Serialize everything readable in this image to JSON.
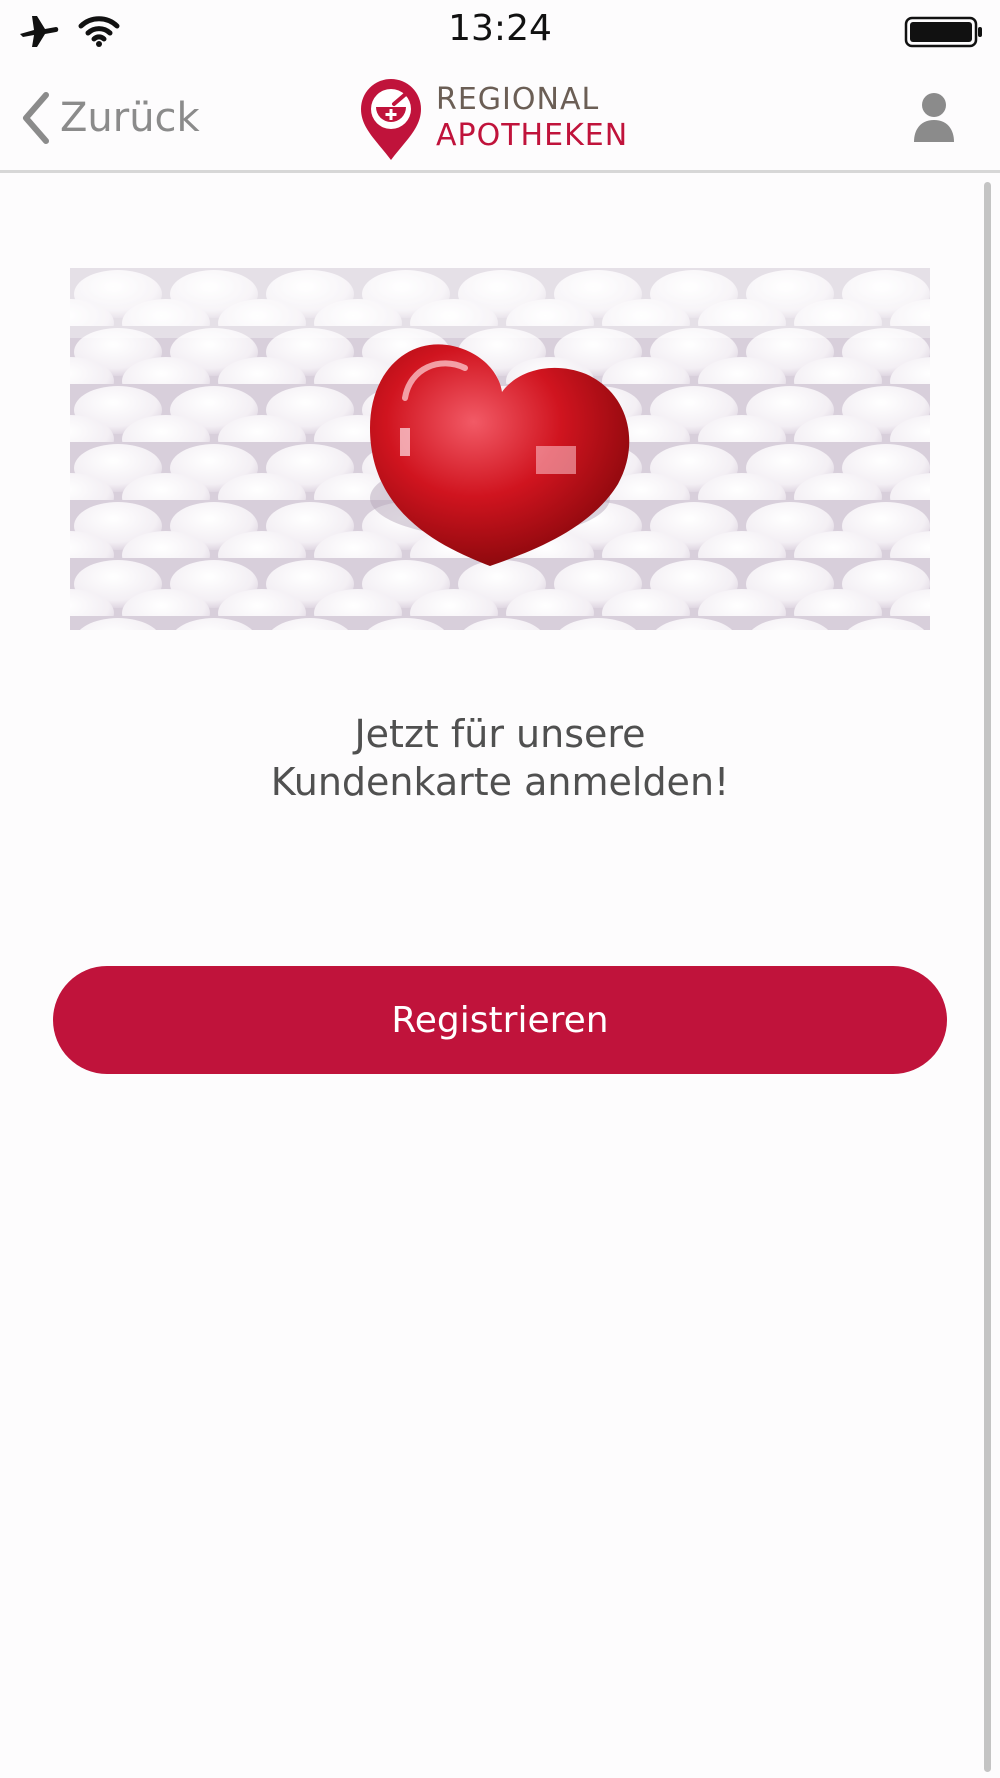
{
  "status_bar": {
    "time": "13:24",
    "icons": [
      "airplane-icon",
      "wifi-icon",
      "battery-icon"
    ]
  },
  "nav": {
    "back_label": "Zurück",
    "logo_line1": "REGIONAL",
    "logo_line2": "APOTHEKEN",
    "profile_icon": "person-icon"
  },
  "hero": {
    "image": "red heart on white pills"
  },
  "main": {
    "headline_line1": "Jetzt für unsere",
    "headline_line2": "Kundenkarte anmelden!",
    "register_label": "Registrieren"
  },
  "colors": {
    "accent": "#c0133b",
    "logo_brown": "#6b5e55",
    "back_gray": "#8b8b8b",
    "text_gray": "#505050"
  }
}
